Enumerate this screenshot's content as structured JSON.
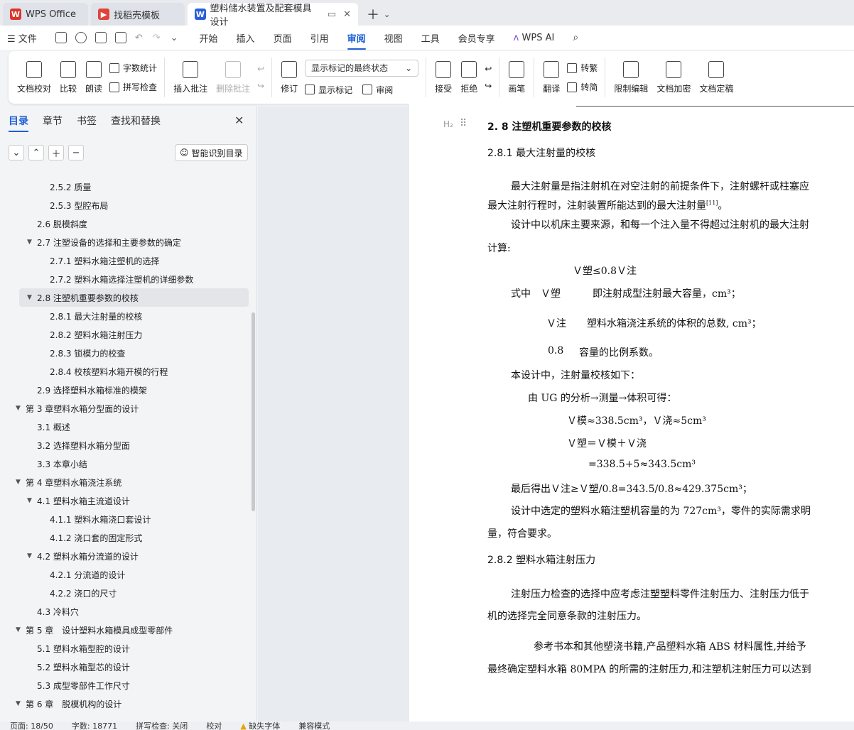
{
  "tabs": [
    {
      "label": "WPS Office",
      "icon": "wps-logo-icon",
      "color": "#d9362b"
    },
    {
      "label": "找稻壳模板",
      "icon": "docer-icon",
      "color": "#e0433a"
    },
    {
      "label": "塑料储水装置及配套模具设计",
      "icon": "word-doc-icon",
      "color": "#2b5fd9"
    }
  ],
  "menu": {
    "file": "文件",
    "items": [
      "开始",
      "插入",
      "页面",
      "引用",
      "审阅",
      "视图",
      "工具",
      "会员专享"
    ],
    "active": "审阅",
    "ai": "WPS AI"
  },
  "ribbon": {
    "proofread": "文档校对",
    "compare": "比较",
    "read_aloud": "朗读",
    "word_count": "字数统计",
    "spell_check": "拼写检查",
    "insert_comment": "插入批注",
    "delete_comment": "删除批注",
    "revise": "修订",
    "markup_state": "显示标记的最终状态",
    "show_markup": "显示标记",
    "review": "审阅",
    "accept": "接受",
    "reject": "拒绝",
    "pen": "画笔",
    "translate": "翻译",
    "to_traditional": "转繁",
    "to_simplified": "转简",
    "restrict": "限制编辑",
    "encrypt": "文档加密",
    "finalize": "文档定稿"
  },
  "nav": {
    "tabs": [
      "目录",
      "章节",
      "书签",
      "查找和替换"
    ],
    "active_tab": "目录",
    "smart_button": "智能识别目录",
    "items": [
      {
        "label": "2.5.2 质量",
        "level": 3,
        "arrow": ""
      },
      {
        "label": "2.5.3 型腔布局",
        "level": 3,
        "arrow": ""
      },
      {
        "label": "2.6 脱模斜度",
        "level": 2,
        "arrow": ""
      },
      {
        "label": "2.7 注塑设备的选择和主要参数的确定",
        "level": 2,
        "arrow": "▼"
      },
      {
        "label": "2.7.1 塑料水箱注塑机的选择",
        "level": 3,
        "arrow": ""
      },
      {
        "label": "2.7.2 塑料水箱选择注塑机的详细参数",
        "level": 3,
        "arrow": ""
      },
      {
        "label": "2.8 注塑机重要参数的校核",
        "level": 2,
        "arrow": "▼",
        "selected": true
      },
      {
        "label": "2.8.1 最大注射量的校核",
        "level": 3,
        "arrow": ""
      },
      {
        "label": "2.8.2 塑料水箱注射压力",
        "level": 3,
        "arrow": ""
      },
      {
        "label": "2.8.3 锁模力的校查",
        "level": 3,
        "arrow": ""
      },
      {
        "label": "2.8.4 校核塑料水箱开模的行程",
        "level": 3,
        "arrow": ""
      },
      {
        "label": "2.9 选择塑料水箱标准的模架",
        "level": 2,
        "arrow": ""
      },
      {
        "label": "第 3 章塑料水箱分型面的设计",
        "level": 1,
        "arrow": "▼"
      },
      {
        "label": "3.1 概述",
        "level": 2,
        "arrow": ""
      },
      {
        "label": "3.2 选择塑料水箱分型面",
        "level": 2,
        "arrow": ""
      },
      {
        "label": "3.3 本章小结",
        "level": 2,
        "arrow": ""
      },
      {
        "label": "第 4 章塑料水箱浇注系统",
        "level": 1,
        "arrow": "▼"
      },
      {
        "label": "4.1 塑料水箱主流道设计",
        "level": 2,
        "arrow": "▼"
      },
      {
        "label": "4.1.1 塑料水箱浇口套设计",
        "level": 3,
        "arrow": ""
      },
      {
        "label": "4.1.2 浇口套的固定形式",
        "level": 3,
        "arrow": ""
      },
      {
        "label": "4.2 塑料水箱分流道的设计",
        "level": 2,
        "arrow": "▼"
      },
      {
        "label": "4.2.1 分流道的设计",
        "level": 3,
        "arrow": ""
      },
      {
        "label": "4.2.2 浇口的尺寸",
        "level": 3,
        "arrow": ""
      },
      {
        "label": "4.3 冷料穴",
        "level": 2,
        "arrow": ""
      },
      {
        "label": "第 5 章　设计塑料水箱模具成型零部件",
        "level": 1,
        "arrow": "▼"
      },
      {
        "label": "5.1 塑料水箱型腔的设计",
        "level": 2,
        "arrow": ""
      },
      {
        "label": "5.2 塑料水箱型芯的设计",
        "level": 2,
        "arrow": ""
      },
      {
        "label": "5.3 成型零部件工作尺寸",
        "level": 2,
        "arrow": ""
      },
      {
        "label": "第 6 章　脱模机构的设计",
        "level": 1,
        "arrow": "▼"
      }
    ]
  },
  "doc": {
    "h2_mark": "H₂",
    "h2": "2. 8 注塑机重要参数的校核",
    "h3a": "2.8.1 最大注射量的校核",
    "p1a": "最大注射量是指注射机在对空注射的前提条件下，注射螺杆或柱塞应",
    "p1b": "最大注射行程时，注射装置所能达到的最大注射量",
    "p1_ref": "[11]",
    "p1_end": "。",
    "p2a": "设计中以机床主要来源，和每一个注入量不得超过注射机的最大注射",
    "p2b": "计算:",
    "formula1": "Ｖ塑≤0.8Ｖ注",
    "where_label": "式中　Ｖ塑",
    "where1": "即注射成型注射最大容量，cm³；",
    "where2_sym": "Ｖ注",
    "where2": "塑料水箱浇注系统的体积的总数, cm³；",
    "where3_sym": "0.8",
    "where3": "容量的比例系数。",
    "check": "本设计中，注射量校核如下：",
    "ug": "由 UG 的分析→测量→体积可得：",
    "vmodel": "Ｖ模≈338.5cm³，Ｖ浇≈5cm³",
    "vsum": "Ｖ塑＝Ｖ模＋Ｖ浇",
    "vcalc": "=338.5+5≈343.5cm³",
    "final": "最后得出Ｖ注≥Ｖ塑/0.8=343.5/0.8≈429.375cm³；",
    "p3a": "设计中选定的塑料水箱注塑机容量的为 727cm³，零件的实际需求明",
    "p3b": "量，符合要求。",
    "h3b": "2.8.2 塑料水箱注射压力",
    "p4a": "注射压力检查的选择中应考虑注塑塑料零件注射压力、注射压力低于",
    "p4b": "机的选择完全同意条款的注射压力。",
    "p5a": "参考书本和其他塑浇书籍,产品塑料水箱 ABS 材料属性,并给予",
    "p5b": "最终确定塑料水箱 80MPA 的所需的注射压力,和注塑机注射压力可以达到"
  },
  "status": {
    "page": "页面: 18/50",
    "words": "字数: 18771",
    "spell": "拼写检查: 关闭",
    "proof": "校对",
    "missing_font": "缺失字体",
    "compat": "兼容模式"
  },
  "colors": {
    "accent": "#1c5fd6",
    "page": "#ffffff",
    "canvas": "#e8ecf0"
  }
}
